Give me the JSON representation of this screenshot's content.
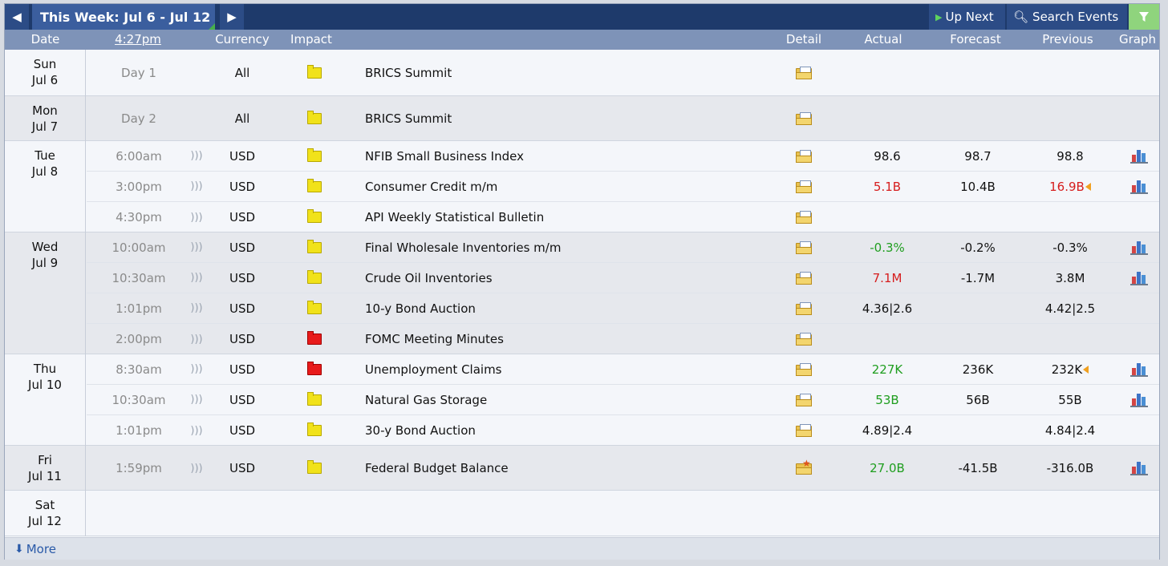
{
  "toolbar": {
    "title": "This Week: Jul 6 - Jul 12",
    "up_next": "Up Next",
    "search_events": "Search Events"
  },
  "columns": {
    "date": "Date",
    "time": "4:27pm",
    "currency": "Currency",
    "impact": "Impact",
    "detail": "Detail",
    "actual": "Actual",
    "forecast": "Forecast",
    "previous": "Previous",
    "graph": "Graph"
  },
  "days": [
    {
      "day": "Sun",
      "date": "Jul 6",
      "events": [
        {
          "time": "Day 1",
          "currency": "All",
          "impact": "yellow",
          "name": "BRICS Summit",
          "actual": "",
          "forecast": "",
          "previous": "",
          "graph": false
        }
      ]
    },
    {
      "day": "Mon",
      "date": "Jul 7",
      "events": [
        {
          "time": "Day 2",
          "currency": "All",
          "impact": "yellow",
          "name": "BRICS Summit",
          "actual": "",
          "forecast": "",
          "previous": "",
          "graph": false
        }
      ]
    },
    {
      "day": "Tue",
      "date": "Jul 8",
      "events": [
        {
          "time": "6:00am",
          "currency": "USD",
          "impact": "yellow",
          "name": "NFIB Small Business Index",
          "actual": "98.6",
          "forecast": "98.7",
          "previous": "98.8",
          "graph": true
        },
        {
          "time": "3:00pm",
          "currency": "USD",
          "impact": "yellow",
          "name": "Consumer Credit m/m",
          "actual": "5.1B",
          "actual_color": "red",
          "forecast": "10.4B",
          "previous": "16.9B",
          "previous_color": "red",
          "revised": true,
          "graph": true
        },
        {
          "time": "4:30pm",
          "currency": "USD",
          "impact": "yellow",
          "name": "API Weekly Statistical Bulletin",
          "actual": "",
          "forecast": "",
          "previous": "",
          "graph": false
        }
      ]
    },
    {
      "day": "Wed",
      "date": "Jul 9",
      "events": [
        {
          "time": "10:00am",
          "currency": "USD",
          "impact": "yellow",
          "name": "Final Wholesale Inventories m/m",
          "actual": "-0.3%",
          "actual_color": "green",
          "forecast": "-0.2%",
          "previous": "-0.3%",
          "graph": true
        },
        {
          "time": "10:30am",
          "currency": "USD",
          "impact": "yellow",
          "name": "Crude Oil Inventories",
          "actual": "7.1M",
          "actual_color": "red",
          "forecast": "-1.7M",
          "previous": "3.8M",
          "graph": true
        },
        {
          "time": "1:01pm",
          "currency": "USD",
          "impact": "yellow",
          "name": "10-y Bond Auction",
          "actual": "4.36|2.6",
          "forecast": "",
          "previous": "4.42|2.5",
          "graph": false
        },
        {
          "time": "2:00pm",
          "currency": "USD",
          "impact": "red",
          "name": "FOMC Meeting Minutes",
          "actual": "",
          "forecast": "",
          "previous": "",
          "graph": false
        }
      ]
    },
    {
      "day": "Thu",
      "date": "Jul 10",
      "events": [
        {
          "time": "8:30am",
          "currency": "USD",
          "impact": "red",
          "name": "Unemployment Claims",
          "actual": "227K",
          "actual_color": "green",
          "forecast": "236K",
          "previous": "232K",
          "revised": true,
          "graph": true
        },
        {
          "time": "10:30am",
          "currency": "USD",
          "impact": "yellow",
          "name": "Natural Gas Storage",
          "actual": "53B",
          "actual_color": "green",
          "forecast": "56B",
          "previous": "55B",
          "graph": true
        },
        {
          "time": "1:01pm",
          "currency": "USD",
          "impact": "yellow",
          "name": "30-y Bond Auction",
          "actual": "4.89|2.4",
          "forecast": "",
          "previous": "4.84|2.4",
          "graph": false
        }
      ]
    },
    {
      "day": "Fri",
      "date": "Jul 11",
      "events": [
        {
          "time": "1:59pm",
          "currency": "USD",
          "impact": "yellow",
          "name": "Federal Budget Balance",
          "actual": "27.0B",
          "actual_color": "green",
          "forecast": "-41.5B",
          "previous": "-316.0B",
          "graph": true,
          "detail_star": true
        }
      ]
    },
    {
      "day": "Sat",
      "date": "Jul 12",
      "events": []
    }
  ],
  "footer": {
    "more": "More"
  }
}
